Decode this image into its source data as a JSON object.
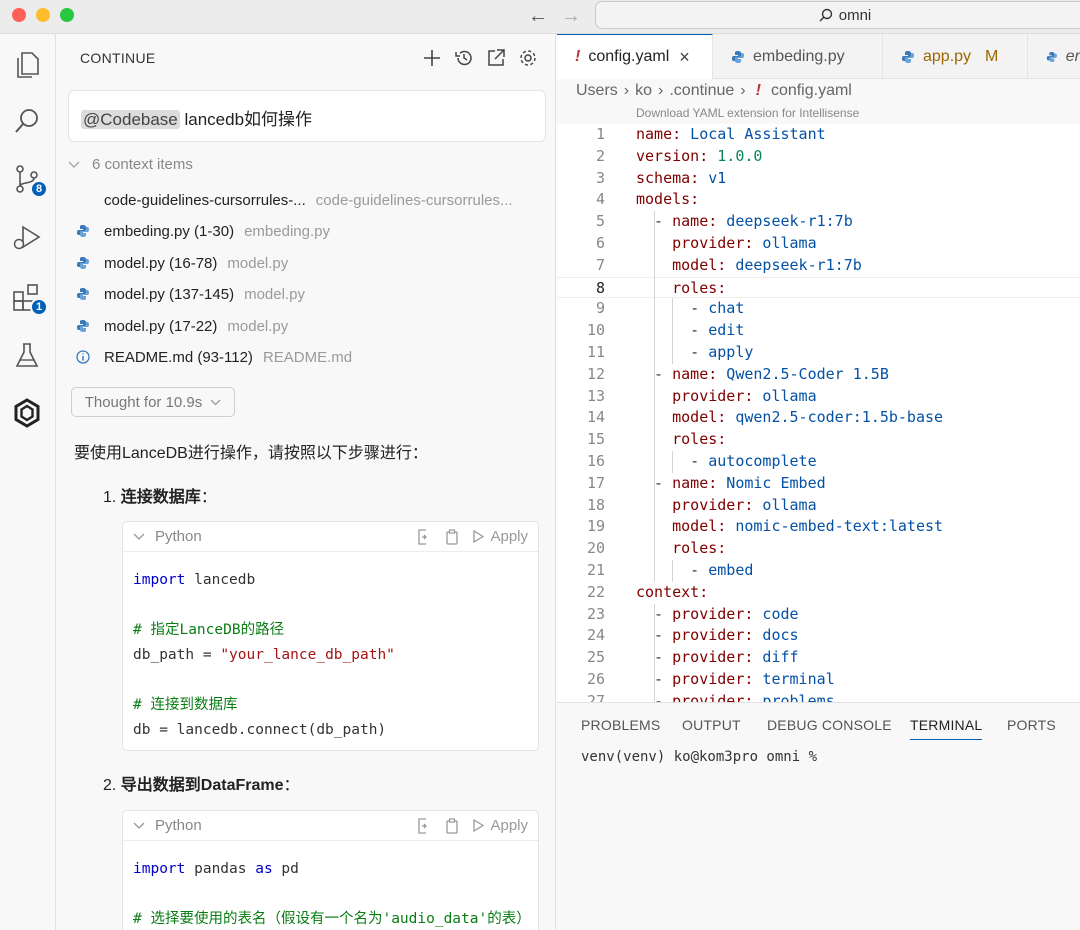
{
  "window": {
    "search_text": "omni"
  },
  "activity": {
    "scm_badge": "8",
    "extensions_badge": "1"
  },
  "continue_panel": {
    "title": "CONTINUE",
    "prompt_mention": "@Codebase",
    "prompt_text": "lancedb如何操作",
    "context_header": "6 context items",
    "context_items": [
      {
        "label": "code-guidelines-cursorrules-...",
        "sub": "code-guidelines-cursorrules...",
        "icon": "blank"
      },
      {
        "label": "embeding.py (1-30)",
        "sub": "embeding.py",
        "icon": "python-icon"
      },
      {
        "label": "model.py (16-78)",
        "sub": "model.py",
        "icon": "python-icon"
      },
      {
        "label": "model.py (137-145)",
        "sub": "model.py",
        "icon": "python-icon"
      },
      {
        "label": "model.py (17-22)",
        "sub": "model.py",
        "icon": "python-icon"
      },
      {
        "label": "README.md (93-112)",
        "sub": "README.md",
        "icon": "info-icon"
      }
    ],
    "thought_label": "Thought for 10.9s",
    "intro": "要使用LanceDB进行操作，请按照以下步骤进行：",
    "step1": {
      "num": "1.",
      "title": "连接数据库",
      "suffix": "："
    },
    "step2": {
      "num": "2.",
      "title": "导出数据到DataFrame",
      "suffix": "："
    },
    "code_lang": "Python",
    "apply_label": "Apply",
    "code1": {
      "l1_kw": "import",
      "l1_rest": " lancedb",
      "l3": "# 指定LanceDB的路径",
      "l4_a": "db_path = ",
      "l4_str": "\"your_lance_db_path\"",
      "l6": "# 连接到数据库",
      "l7": "db = lancedb.connect(db_path)"
    },
    "code2": {
      "l1_kw": "import",
      "l1_mid": " pandas ",
      "l1_kw2": "as",
      "l1_rest": " pd",
      "l3": "# 选择要使用的表名（假设有一个名为'audio_data'的表）"
    }
  },
  "tabs": [
    {
      "label": "config.yaml",
      "active": true
    },
    {
      "label": "embeding.py"
    },
    {
      "label": "app.py",
      "badge": "M"
    },
    {
      "label": "er"
    }
  ],
  "breadcrumb": [
    "Users",
    "ko",
    ".continue",
    "config.yaml"
  ],
  "yaml_hint": "Download YAML extension for Intellisense",
  "editor_lines": [
    {
      "n": "1",
      "k": "name:",
      "v": " Local Assistant",
      "vt": "yv"
    },
    {
      "n": "2",
      "k": "version:",
      "v": " 1.0.0",
      "vt": "yn"
    },
    {
      "n": "3",
      "k": "schema:",
      "v": " v1",
      "vt": "yv"
    },
    {
      "n": "4",
      "k": "models:",
      "v": "",
      "vt": "yv"
    },
    {
      "n": "5",
      "p": "  - ",
      "k": "name:",
      "v": " deepseek-r1:7b",
      "vt": "yv"
    },
    {
      "n": "6",
      "p": "    ",
      "k": "provider:",
      "v": " ollama",
      "vt": "yv"
    },
    {
      "n": "7",
      "p": "    ",
      "k": "model:",
      "v": " deepseek-r1:7b",
      "vt": "yv"
    },
    {
      "n": "8",
      "p": "    ",
      "k": "roles:",
      "v": "",
      "vt": "yv"
    },
    {
      "n": "9",
      "p": "      - ",
      "k": "",
      "v": "chat",
      "vt": "yv"
    },
    {
      "n": "10",
      "p": "      - ",
      "k": "",
      "v": "edit",
      "vt": "yv"
    },
    {
      "n": "11",
      "p": "      - ",
      "k": "",
      "v": "apply",
      "vt": "yv"
    },
    {
      "n": "12",
      "p": "  - ",
      "k": "name:",
      "v": " Qwen2.5-Coder 1.5B",
      "vt": "yv"
    },
    {
      "n": "13",
      "p": "    ",
      "k": "provider:",
      "v": " ollama",
      "vt": "yv"
    },
    {
      "n": "14",
      "p": "    ",
      "k": "model:",
      "v": " qwen2.5-coder:1.5b-base",
      "vt": "yv"
    },
    {
      "n": "15",
      "p": "    ",
      "k": "roles:",
      "v": "",
      "vt": "yv"
    },
    {
      "n": "16",
      "p": "      - ",
      "k": "",
      "v": "autocomplete",
      "vt": "yv"
    },
    {
      "n": "17",
      "p": "  - ",
      "k": "name:",
      "v": " Nomic Embed",
      "vt": "yv"
    },
    {
      "n": "18",
      "p": "    ",
      "k": "provider:",
      "v": " ollama",
      "vt": "yv"
    },
    {
      "n": "19",
      "p": "    ",
      "k": "model:",
      "v": " nomic-embed-text:latest",
      "vt": "yv"
    },
    {
      "n": "20",
      "p": "    ",
      "k": "roles:",
      "v": "",
      "vt": "yv"
    },
    {
      "n": "21",
      "p": "      - ",
      "k": "",
      "v": "embed",
      "vt": "yv"
    },
    {
      "n": "22",
      "k": "context:",
      "v": "",
      "vt": "yv"
    },
    {
      "n": "23",
      "p": "  - ",
      "k": "provider:",
      "v": " code",
      "vt": "yv"
    },
    {
      "n": "24",
      "p": "  - ",
      "k": "provider:",
      "v": " docs",
      "vt": "yv"
    },
    {
      "n": "25",
      "p": "  - ",
      "k": "provider:",
      "v": " diff",
      "vt": "yv"
    },
    {
      "n": "26",
      "p": "  - ",
      "k": "provider:",
      "v": " terminal",
      "vt": "yv"
    },
    {
      "n": "27",
      "p": "  - ",
      "k": "provider:",
      "v": " problems",
      "vt": "yv"
    }
  ],
  "current_line": "8",
  "bottom_panel": {
    "tabs": [
      "PROBLEMS",
      "OUTPUT",
      "DEBUG CONSOLE",
      "TERMINAL",
      "PORTS"
    ],
    "active_tab": "TERMINAL",
    "terminal_text": "venv(venv) ko@kom3pro omni %"
  },
  "colors": {
    "accent": "#005fb8",
    "yaml_key": "#800000",
    "yaml_value": "#0451a5",
    "yaml_number": "#098658"
  }
}
